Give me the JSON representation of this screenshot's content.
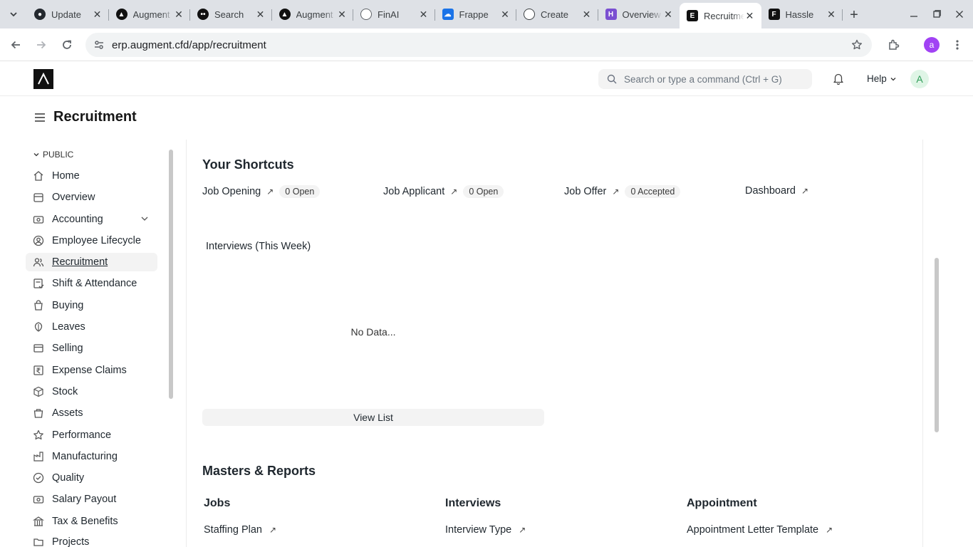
{
  "browser": {
    "tabs": [
      {
        "title": "Update",
        "favicon": "github-icon",
        "color": "#24292f"
      },
      {
        "title": "Augment",
        "favicon": "augment-icon",
        "color": "#111111"
      },
      {
        "title": "Search",
        "favicon": "search-site-icon",
        "color": "#111111"
      },
      {
        "title": "Augment",
        "favicon": "augment-icon",
        "color": "#111111"
      },
      {
        "title": "FinAI",
        "favicon": "globe-icon",
        "color": "#5f6368"
      },
      {
        "title": "Frappe",
        "favicon": "cloud-icon",
        "color": "#1a73e8"
      },
      {
        "title": "Create",
        "favicon": "openai-icon",
        "color": "#3c4043"
      },
      {
        "title": "Overview",
        "favicon": "hasura-icon",
        "color": "#7a4fd1"
      },
      {
        "title": "Recruitment",
        "favicon": "erpnext-icon",
        "color": "#111111"
      },
      {
        "title": "Hassle",
        "favicon": "frappe-icon",
        "color": "#111111"
      }
    ],
    "active_tab": 8,
    "url": "erp.augment.cfd/app/recruitment",
    "profile_initial": "a"
  },
  "navbar": {
    "search_placeholder": "Search or type a command (Ctrl + G)",
    "help_label": "Help",
    "avatar_initial": "A"
  },
  "page": {
    "title": "Recruitment"
  },
  "sidebar": {
    "section_label": "PUBLIC",
    "items": [
      {
        "label": "Home",
        "icon": "home-icon"
      },
      {
        "label": "Overview",
        "icon": "overview-icon"
      },
      {
        "label": "Accounting",
        "icon": "accounting-icon",
        "expandable": true
      },
      {
        "label": "Employee Lifecycle",
        "icon": "employee-icon"
      },
      {
        "label": "Recruitment",
        "icon": "recruitment-icon",
        "active": true
      },
      {
        "label": "Shift & Attendance",
        "icon": "attendance-icon"
      },
      {
        "label": "Buying",
        "icon": "buying-icon"
      },
      {
        "label": "Leaves",
        "icon": "leaves-icon"
      },
      {
        "label": "Selling",
        "icon": "selling-icon"
      },
      {
        "label": "Expense Claims",
        "icon": "rupee-icon"
      },
      {
        "label": "Stock",
        "icon": "stock-icon"
      },
      {
        "label": "Assets",
        "icon": "assets-icon"
      },
      {
        "label": "Performance",
        "icon": "star-icon"
      },
      {
        "label": "Manufacturing",
        "icon": "manufacturing-icon"
      },
      {
        "label": "Quality",
        "icon": "quality-icon"
      },
      {
        "label": "Salary Payout",
        "icon": "salary-icon"
      },
      {
        "label": "Tax & Benefits",
        "icon": "tax-icon"
      },
      {
        "label": "Projects",
        "icon": "projects-icon"
      }
    ]
  },
  "shortcuts": {
    "heading": "Your Shortcuts",
    "items": [
      {
        "label": "Job Opening",
        "badge": "0 Open"
      },
      {
        "label": "Job Applicant",
        "badge": "0 Open"
      },
      {
        "label": "Job Offer",
        "badge": "0 Accepted"
      },
      {
        "label": "Dashboard",
        "badge": ""
      }
    ]
  },
  "chart": {
    "title": "Interviews (This Week)",
    "empty_text": "No Data...",
    "view_list_label": "View List"
  },
  "masters": {
    "heading": "Masters & Reports",
    "cards": [
      {
        "title": "Jobs",
        "links": [
          "Staffing Plan"
        ]
      },
      {
        "title": "Interviews",
        "links": [
          "Interview Type"
        ]
      },
      {
        "title": "Appointment",
        "links": [
          "Appointment Letter Template"
        ]
      }
    ]
  }
}
